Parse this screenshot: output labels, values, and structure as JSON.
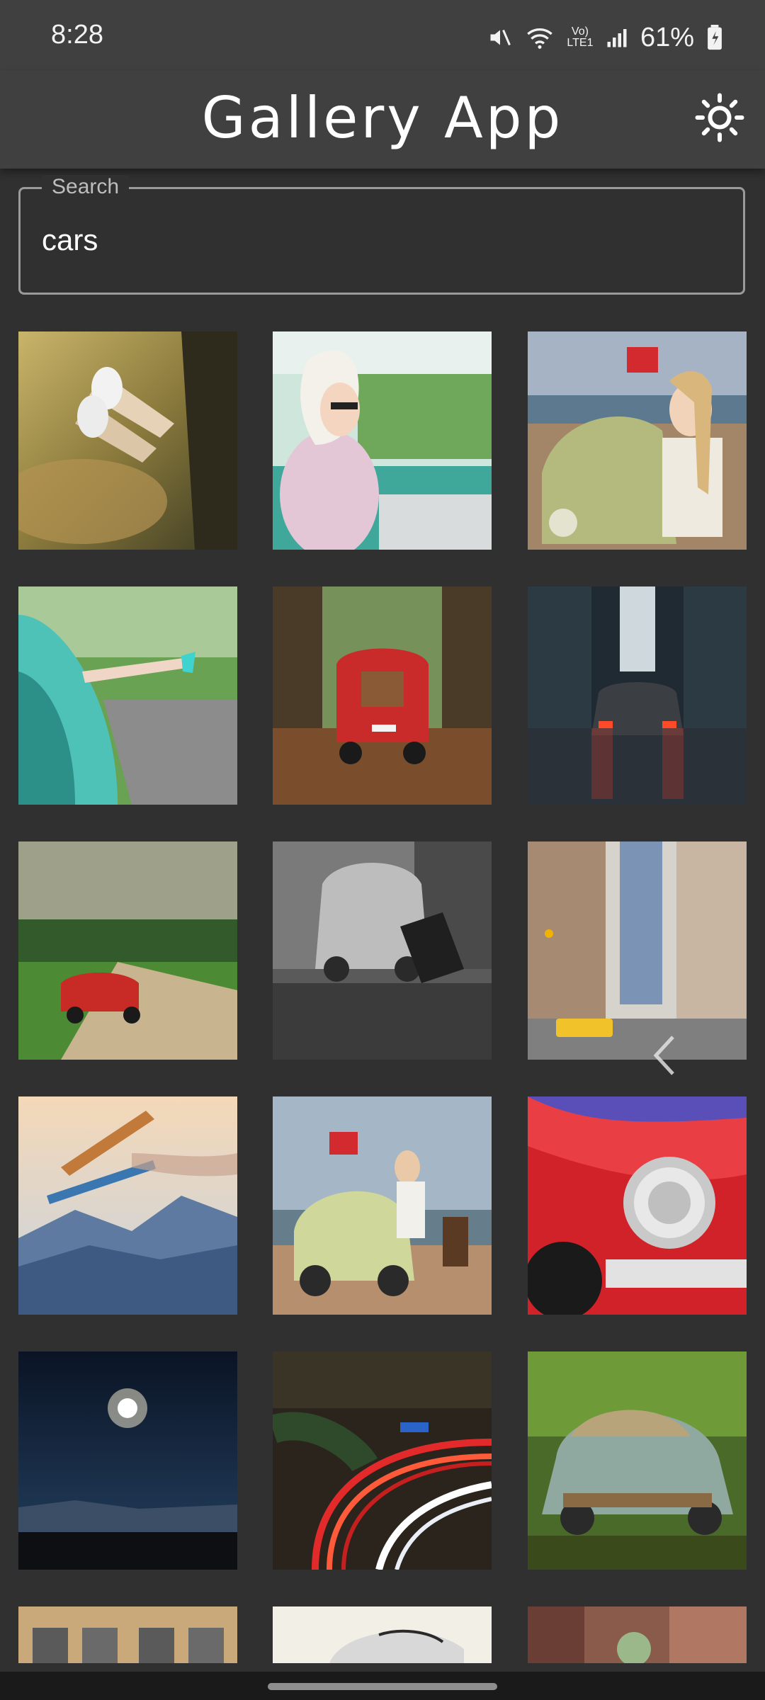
{
  "status": {
    "time": "8:28",
    "battery": "61%",
    "network": "Vo) LTE1"
  },
  "app": {
    "title": "Gallery App",
    "theme_icon": "sun-icon"
  },
  "search": {
    "label": "Search",
    "value": "cars"
  },
  "gallery": {
    "images": [
      {
        "subject": "feet-out-car-window"
      },
      {
        "subject": "woman-driving-vintage-car"
      },
      {
        "subject": "woman-with-beetle-beach"
      },
      {
        "subject": "legs-out-teal-car"
      },
      {
        "subject": "red-fiat-forest-road"
      },
      {
        "subject": "car-rainy-city-night"
      },
      {
        "subject": "red-convertible-dirt-road"
      },
      {
        "subject": "bw-beetle-city"
      },
      {
        "subject": "new-york-street-taxi"
      },
      {
        "subject": "biplane-mountains"
      },
      {
        "subject": "beetle-woman-luggage-beach"
      },
      {
        "subject": "red-classic-car-headlight"
      },
      {
        "subject": "moon-night-sky"
      },
      {
        "subject": "light-trails-highway"
      },
      {
        "subject": "abandoned-rusty-car"
      },
      {
        "subject": "building-windows"
      },
      {
        "subject": "white-vintage-car"
      },
      {
        "subject": "city-street-sunlight"
      }
    ]
  },
  "colors": {
    "background": "#303030",
    "appbar": "#404040",
    "outline": "#9a9a9a"
  }
}
